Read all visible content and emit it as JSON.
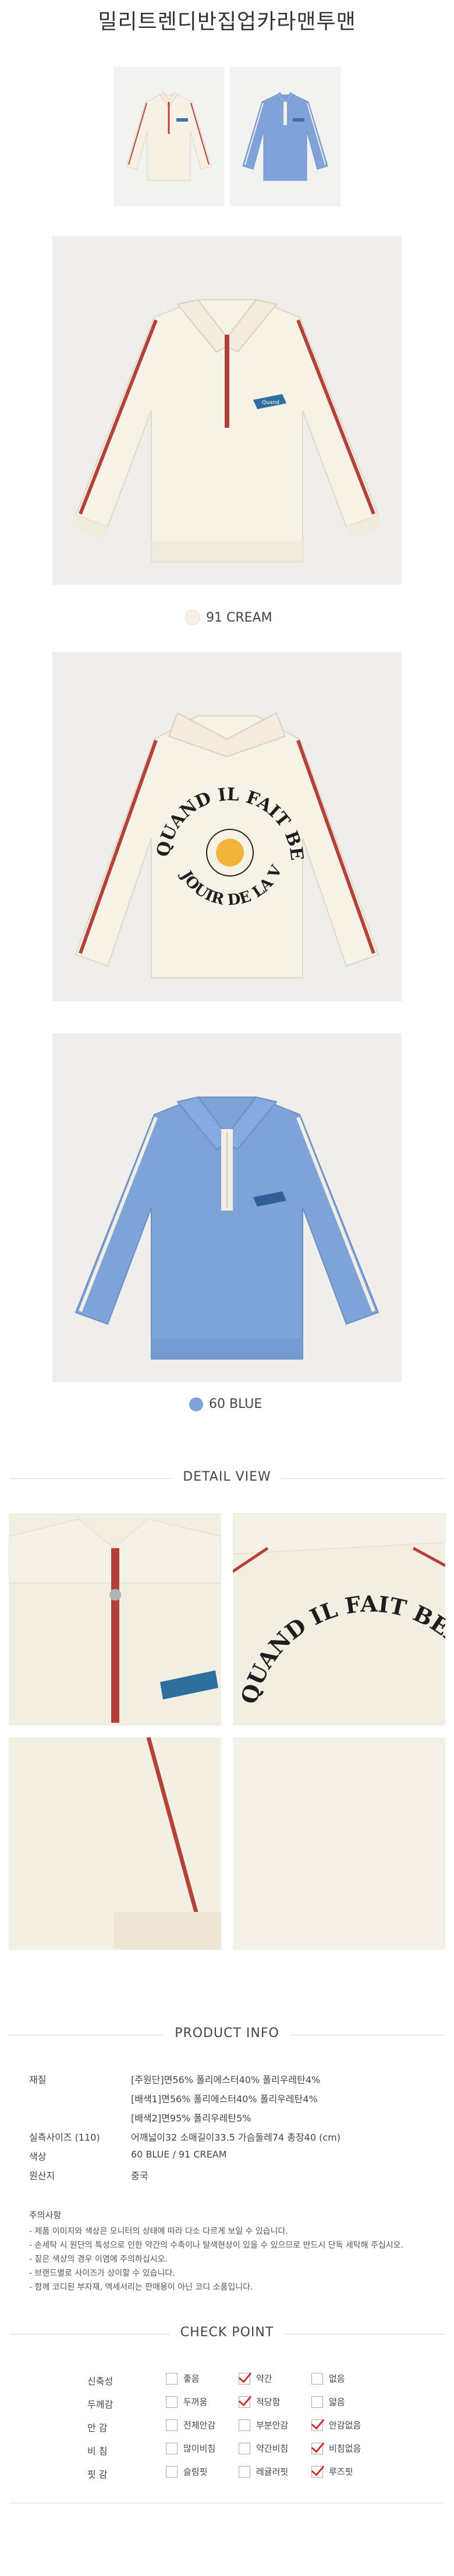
{
  "product": {
    "title": "밀리트렌디반집업카라맨투맨"
  },
  "thumbnails": [
    {
      "name": "cream-thumb",
      "color": "#f6f1e4"
    },
    {
      "name": "blue-thumb",
      "color": "#7fa3d9"
    }
  ],
  "colors": [
    {
      "label": "91 CREAM",
      "swatch": "#f6f1e4"
    },
    {
      "label": "60 BLUE",
      "swatch": "#7fa3d9"
    }
  ],
  "back_print": {
    "arc_text": "QUAND IL FAIT BEAU",
    "bottom_text": "JOUIR DE LA VIE"
  },
  "detail": {
    "title": "DETAIL VIEW",
    "zoom_print": "QUAND IL FAIT BEAU"
  },
  "product_info": {
    "title": "PRODUCT INFO",
    "rows": [
      {
        "label": "재질",
        "lines": [
          "[주원단]면56% 폴리에스터40% 폴리우레탄4%",
          "[배색1]면56% 폴리에스터40% 폴리우레탄4%",
          "[배색2]면95% 폴리우레탄5%"
        ]
      },
      {
        "label": "실측사이즈 (110)",
        "lines": [
          "어깨넓이32 소매길이33.5 가슴둘레74 총장40 (cm)"
        ]
      },
      {
        "label": "색상",
        "lines": [
          "60 BLUE / 91 CREAM"
        ]
      },
      {
        "label": "원산지",
        "lines": [
          "중국"
        ]
      }
    ]
  },
  "notice": {
    "title": "주의사항",
    "lines": [
      "- 제품 이미지와 색상은 모니터의 상태에 따라 다소 다르게 보일 수 있습니다.",
      "- 손세탁 시 원단의 특성으로 인한 약간의 수축이나 탈색현상이 있을 수 있으므로 반드시 단독 세탁해 주십시오.",
      "- 짙은 색상의 경우 이염에 주의하십시오.",
      "- 브랜드별로 사이즈가 상이할 수 있습니다.",
      "- 함께 코디된 부자재, 액세서리는 판매용이 아닌 코디 소품입니다."
    ]
  },
  "check_point": {
    "title": "CHECK POINT",
    "rows": [
      {
        "label": "신축성",
        "options": [
          {
            "text": "좋음",
            "checked": false
          },
          {
            "text": "약간",
            "checked": true
          },
          {
            "text": "없음",
            "checked": false
          }
        ]
      },
      {
        "label": "두께감",
        "options": [
          {
            "text": "두꺼움",
            "checked": false
          },
          {
            "text": "적당함",
            "checked": true
          },
          {
            "text": "얇음",
            "checked": false
          }
        ]
      },
      {
        "label": "안 감",
        "options": [
          {
            "text": "전체안감",
            "checked": false
          },
          {
            "text": "부분안감",
            "checked": false
          },
          {
            "text": "안감없음",
            "checked": true
          }
        ]
      },
      {
        "label": "비 침",
        "options": [
          {
            "text": "많이비침",
            "checked": false
          },
          {
            "text": "약간비침",
            "checked": false
          },
          {
            "text": "비침없음",
            "checked": true
          }
        ]
      },
      {
        "label": "핏 감",
        "options": [
          {
            "text": "슬림핏",
            "checked": false
          },
          {
            "text": "레귤러핏",
            "checked": false
          },
          {
            "text": "루즈핏",
            "checked": true
          }
        ]
      }
    ]
  }
}
